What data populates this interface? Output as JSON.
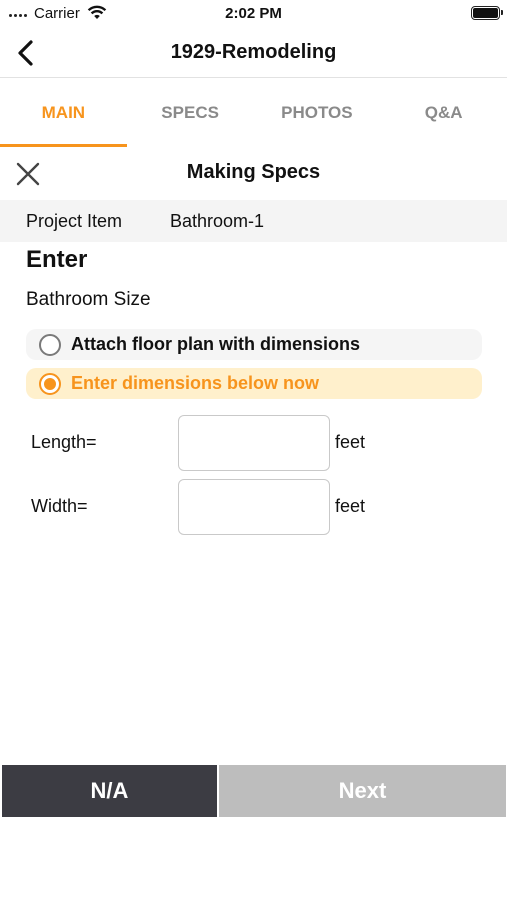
{
  "status_bar": {
    "carrier": "Carrier",
    "time": "2:02 PM"
  },
  "nav": {
    "title": "1929-Remodeling"
  },
  "tabs": [
    {
      "label": "MAIN",
      "active": true
    },
    {
      "label": "SPECS",
      "active": false
    },
    {
      "label": "PHOTOS",
      "active": false
    },
    {
      "label": "Q&A",
      "active": false
    }
  ],
  "modal": {
    "title": "Making Specs"
  },
  "project": {
    "label": "Project Item",
    "value": "Bathroom-1"
  },
  "form": {
    "heading": "Enter",
    "question": "Bathroom Size",
    "options": [
      {
        "label": "Attach floor plan with dimensions",
        "selected": false
      },
      {
        "label": "Enter dimensions below now",
        "selected": true
      }
    ],
    "length": {
      "label": "Length=",
      "value": "",
      "unit": "feet"
    },
    "width": {
      "label": "Width=",
      "value": "",
      "unit": "feet"
    }
  },
  "buttons": {
    "na": "N/A",
    "next": "Next"
  },
  "colors": {
    "accent": "#f7941d",
    "selected_bg": "#fff0cc",
    "na_bg": "#3c3c43",
    "next_bg": "#bdbdbd"
  }
}
